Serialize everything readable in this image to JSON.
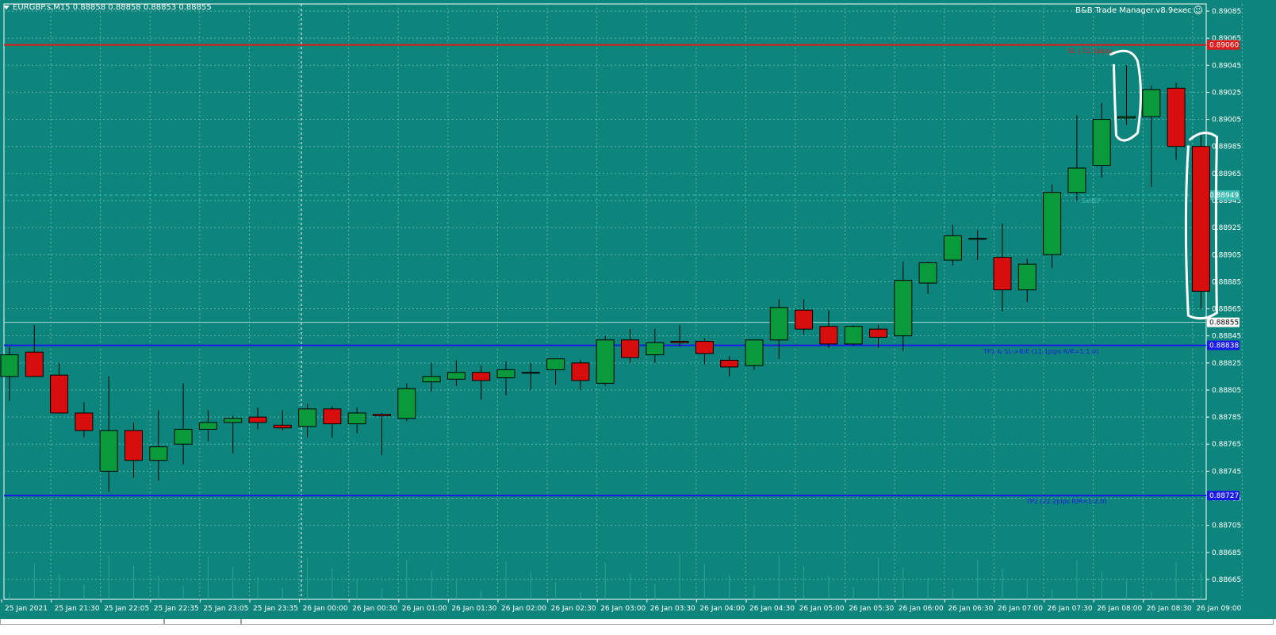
{
  "window": {
    "symbol_info": "EURGBP.s,M15  0.88858 0.88858 0.88853 0.88855",
    "ea_name": "B&B Trade Manager.v8.9exec",
    "ea_icon": "smiley-icon"
  },
  "lines": {
    "sl": {
      "label": "SL (-11.1pips)",
      "price": 0.8906,
      "price_label": "0.89060",
      "color": "#e01a1a"
    },
    "sell_ep": {
      "label": "SellEP",
      "price": 0.88949,
      "price_label": "0.88949",
      "color": "#3dbdb2"
    },
    "tp1": {
      "label": "TP1 & SL->B/E (11.1pips R/R=1:1.0)",
      "price": 0.88838,
      "price_label": "0.88838",
      "color": "#1a1ae6"
    },
    "tp2": {
      "label": "TP2 (22.2pips R/R=1:2.0)",
      "price": 0.88727,
      "price_label": "0.88727",
      "color": "#1a1ae6"
    },
    "current": {
      "price": 0.88855,
      "price_label": "0.88855"
    }
  },
  "colors": {
    "background": "#0e857c",
    "bull": "#0a9a3c",
    "bear": "#d80d0d",
    "wick": "#000000",
    "grid": "#5fb5ad",
    "axis_text": "#ffffff"
  },
  "chart_data": {
    "type": "candlestick",
    "y_range": [
      0.88655,
      0.89085
    ],
    "y_ticks": [
      "0.89085",
      "0.89065",
      "0.89045",
      "0.89025",
      "0.89005",
      "0.88985",
      "0.88965",
      "0.88945",
      "0.88925",
      "0.88905",
      "0.88885",
      "0.88865",
      "0.88845",
      "0.88825",
      "0.88805",
      "0.88785",
      "0.88765",
      "0.88745",
      "0.88725",
      "0.88705",
      "0.88685",
      "0.88665"
    ],
    "x_labels": [
      "25 Jan 2021",
      "25 Jan 21:30",
      "25 Jan 22:05",
      "25 Jan 22:35",
      "25 Jan 23:05",
      "25 Jan 23:35",
      "26 Jan 00:00",
      "26 Jan 00:30",
      "26 Jan 01:00",
      "26 Jan 01:30",
      "26 Jan 02:00",
      "26 Jan 02:30",
      "26 Jan 03:00",
      "26 Jan 03:30",
      "26 Jan 04:00",
      "26 Jan 04:30",
      "26 Jan 05:00",
      "26 Jan 05:30",
      "26 Jan 06:00",
      "26 Jan 06:30",
      "26 Jan 07:00",
      "26 Jan 07:30",
      "26 Jan 08:00",
      "26 Jan 08:30",
      "26 Jan 09:00"
    ],
    "candles": [
      {
        "o": 0.88815,
        "h": 0.88837,
        "l": 0.88797,
        "c": 0.88831
      },
      {
        "o": 0.88833,
        "h": 0.88853,
        "l": 0.88815,
        "c": 0.88815
      },
      {
        "o": 0.88816,
        "h": 0.88825,
        "l": 0.88788,
        "c": 0.88788
      },
      {
        "o": 0.88788,
        "h": 0.88796,
        "l": 0.8877,
        "c": 0.88775
      },
      {
        "o": 0.88745,
        "h": 0.88815,
        "l": 0.8873,
        "c": 0.88775
      },
      {
        "o": 0.88775,
        "h": 0.88781,
        "l": 0.8874,
        "c": 0.88753
      },
      {
        "o": 0.88753,
        "h": 0.8879,
        "l": 0.88738,
        "c": 0.88763
      },
      {
        "o": 0.88765,
        "h": 0.8881,
        "l": 0.8875,
        "c": 0.88776
      },
      {
        "o": 0.88776,
        "h": 0.8879,
        "l": 0.88767,
        "c": 0.88781
      },
      {
        "o": 0.88781,
        "h": 0.88786,
        "l": 0.88758,
        "c": 0.88784
      },
      {
        "o": 0.88785,
        "h": 0.88792,
        "l": 0.88776,
        "c": 0.88781
      },
      {
        "o": 0.88779,
        "h": 0.8879,
        "l": 0.88775,
        "c": 0.88777
      },
      {
        "o": 0.88778,
        "h": 0.88795,
        "l": 0.8877,
        "c": 0.88791
      },
      {
        "o": 0.88791,
        "h": 0.88793,
        "l": 0.8877,
        "c": 0.8878
      },
      {
        "o": 0.8878,
        "h": 0.88792,
        "l": 0.88773,
        "c": 0.88788
      },
      {
        "o": 0.88787,
        "h": 0.88788,
        "l": 0.88757,
        "c": 0.88786
      },
      {
        "o": 0.88784,
        "h": 0.8881,
        "l": 0.88782,
        "c": 0.88806
      },
      {
        "o": 0.88811,
        "h": 0.88825,
        "l": 0.88804,
        "c": 0.88815
      },
      {
        "o": 0.88813,
        "h": 0.88827,
        "l": 0.88808,
        "c": 0.88818
      },
      {
        "o": 0.88818,
        "h": 0.88823,
        "l": 0.88798,
        "c": 0.88812
      },
      {
        "o": 0.88814,
        "h": 0.88826,
        "l": 0.88801,
        "c": 0.8882
      },
      {
        "o": 0.88818,
        "h": 0.88825,
        "l": 0.88805,
        "c": 0.88818
      },
      {
        "o": 0.8882,
        "h": 0.88828,
        "l": 0.88809,
        "c": 0.88828
      },
      {
        "o": 0.88825,
        "h": 0.88827,
        "l": 0.88805,
        "c": 0.88812
      },
      {
        "o": 0.8881,
        "h": 0.88845,
        "l": 0.88808,
        "c": 0.88842
      },
      {
        "o": 0.88842,
        "h": 0.8885,
        "l": 0.88825,
        "c": 0.88829
      },
      {
        "o": 0.88831,
        "h": 0.8885,
        "l": 0.88825,
        "c": 0.8884
      },
      {
        "o": 0.88841,
        "h": 0.88853,
        "l": 0.88837,
        "c": 0.8884
      },
      {
        "o": 0.88841,
        "h": 0.88843,
        "l": 0.88824,
        "c": 0.88832
      },
      {
        "o": 0.88827,
        "h": 0.8883,
        "l": 0.88815,
        "c": 0.88822
      },
      {
        "o": 0.88823,
        "h": 0.88842,
        "l": 0.8882,
        "c": 0.88842
      },
      {
        "o": 0.88842,
        "h": 0.88872,
        "l": 0.88828,
        "c": 0.88866
      },
      {
        "o": 0.88864,
        "h": 0.88872,
        "l": 0.88846,
        "c": 0.8885
      },
      {
        "o": 0.88852,
        "h": 0.88864,
        "l": 0.88836,
        "c": 0.88839
      },
      {
        "o": 0.88839,
        "h": 0.88853,
        "l": 0.88838,
        "c": 0.88852
      },
      {
        "o": 0.8885,
        "h": 0.88853,
        "l": 0.88836,
        "c": 0.88844
      },
      {
        "o": 0.88845,
        "h": 0.889,
        "l": 0.88834,
        "c": 0.88886
      },
      {
        "o": 0.88884,
        "h": 0.889,
        "l": 0.88876,
        "c": 0.88899
      },
      {
        "o": 0.88901,
        "h": 0.88927,
        "l": 0.88897,
        "c": 0.88919
      },
      {
        "o": 0.88917,
        "h": 0.88923,
        "l": 0.88901,
        "c": 0.88917
      },
      {
        "o": 0.88903,
        "h": 0.88928,
        "l": 0.88863,
        "c": 0.88879
      },
      {
        "o": 0.88879,
        "h": 0.88902,
        "l": 0.8887,
        "c": 0.88898
      },
      {
        "o": 0.88905,
        "h": 0.88957,
        "l": 0.88895,
        "c": 0.88951
      },
      {
        "o": 0.88951,
        "h": 0.89008,
        "l": 0.88945,
        "c": 0.88969
      },
      {
        "o": 0.88971,
        "h": 0.89017,
        "l": 0.88962,
        "c": 0.89005
      },
      {
        "o": 0.89006,
        "h": 0.89045,
        "l": 0.89001,
        "c": 0.89007
      },
      {
        "o": 0.89007,
        "h": 0.8903,
        "l": 0.88955,
        "c": 0.89027
      },
      {
        "o": 0.89028,
        "h": 0.89032,
        "l": 0.88975,
        "c": 0.88985
      },
      {
        "o": 0.88985,
        "h": 0.88995,
        "l": 0.88865,
        "c": 0.88878
      }
    ],
    "annotations": [
      "highlight-candle-08:00",
      "highlight-candle-09:00"
    ]
  }
}
